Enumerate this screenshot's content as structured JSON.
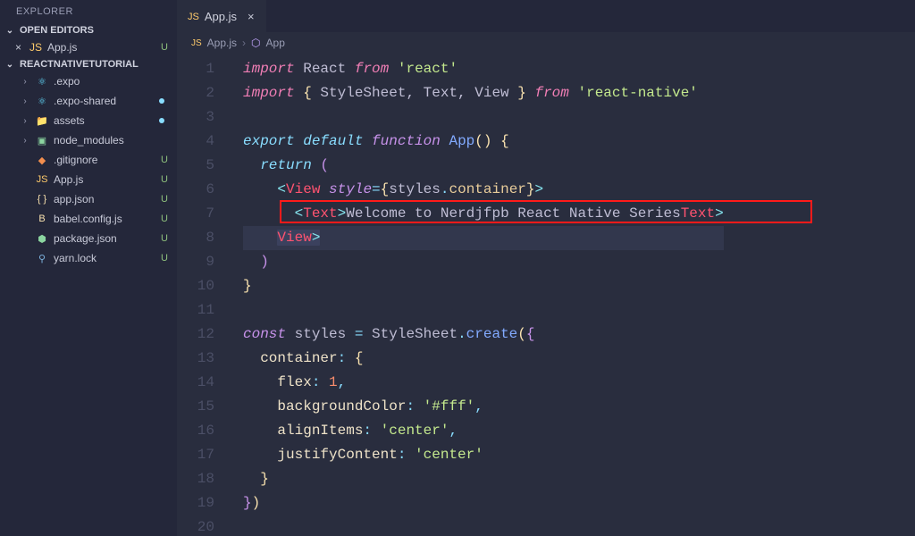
{
  "sidebar": {
    "title": "EXPLORER",
    "openEditorsHeader": "OPEN EDITORS",
    "openEditors": [
      {
        "label": "App.js",
        "iconClass": "ic-js",
        "git": "U"
      }
    ],
    "projectHeader": "REACTNATIVETUTORIAL",
    "tree": [
      {
        "label": ".expo",
        "type": "folder",
        "iconClass": "ic-react",
        "git": "",
        "dot": false
      },
      {
        "label": ".expo-shared",
        "type": "folder",
        "iconClass": "ic-react",
        "git": "",
        "dot": true
      },
      {
        "label": "assets",
        "type": "folder",
        "iconClass": "ic-assets",
        "git": "",
        "dot": true
      },
      {
        "label": "node_modules",
        "type": "folder",
        "iconClass": "ic-node",
        "git": "",
        "dot": false
      },
      {
        "label": ".gitignore",
        "type": "file",
        "iconClass": "ic-git",
        "git": "U",
        "dot": false
      },
      {
        "label": "App.js",
        "type": "file",
        "iconClass": "ic-js",
        "git": "U",
        "dot": false
      },
      {
        "label": "app.json",
        "type": "file",
        "iconClass": "ic-json",
        "git": "U",
        "dot": false
      },
      {
        "label": "babel.config.js",
        "type": "file",
        "iconClass": "ic-babel",
        "git": "U",
        "dot": false
      },
      {
        "label": "package.json",
        "type": "file",
        "iconClass": "ic-pkg",
        "git": "U",
        "dot": false
      },
      {
        "label": "yarn.lock",
        "type": "file",
        "iconClass": "ic-yarn",
        "git": "U",
        "dot": false
      }
    ]
  },
  "tabs": [
    {
      "label": "App.js",
      "iconClass": "ic-js",
      "active": true
    }
  ],
  "breadcrumb": {
    "file": "App.js",
    "symbol": "App"
  },
  "highlightedText": "Welcome to Nerdjfpb React Native Series",
  "code": {
    "lines": 20,
    "importReact": {
      "kw": "import",
      "name": "React",
      "from": "from",
      "mod": "'react'"
    },
    "importRN": {
      "kw": "import",
      "open": "{ ",
      "items": "StyleSheet, Text, View",
      "close": " }",
      "from": "from",
      "mod": "'react-native'"
    },
    "exportLine": {
      "export": "export",
      "default": "default",
      "function": "function",
      "name": "App",
      "parens": "()",
      "brace": " {"
    },
    "returnKW": "return",
    "viewOpen": {
      "lt": "<",
      "tag": "View",
      "attr": "style",
      "eq": "=",
      "lb": "{",
      "obj": "styles",
      "dot": ".",
      "prop": "container",
      "rb": "}",
      "gt": ">"
    },
    "textLine": {
      "lt": "<",
      "tag": "Text",
      "gt": ">",
      "content": "Welcome to Nerdjfpb React Native Series",
      "lt2": "</",
      "gt2": ">"
    },
    "viewClose": {
      "lt": "</",
      "tag": "View",
      "gt": ">"
    },
    "stylesLine": {
      "const": "const",
      "name": "styles",
      "eq": " = ",
      "cls": "StyleSheet",
      "dot": ".",
      "fn": "create",
      "open": "({"
    },
    "containerKey": "container",
    "flexKey": "flex",
    "flexVal": "1",
    "bgKey": "backgroundColor",
    "bgVal": "'#fff'",
    "alignKey": "alignItems",
    "alignVal": "'center'",
    "justifyKey": "justifyContent",
    "justifyVal": "'center'",
    "closeBraces": "})"
  }
}
